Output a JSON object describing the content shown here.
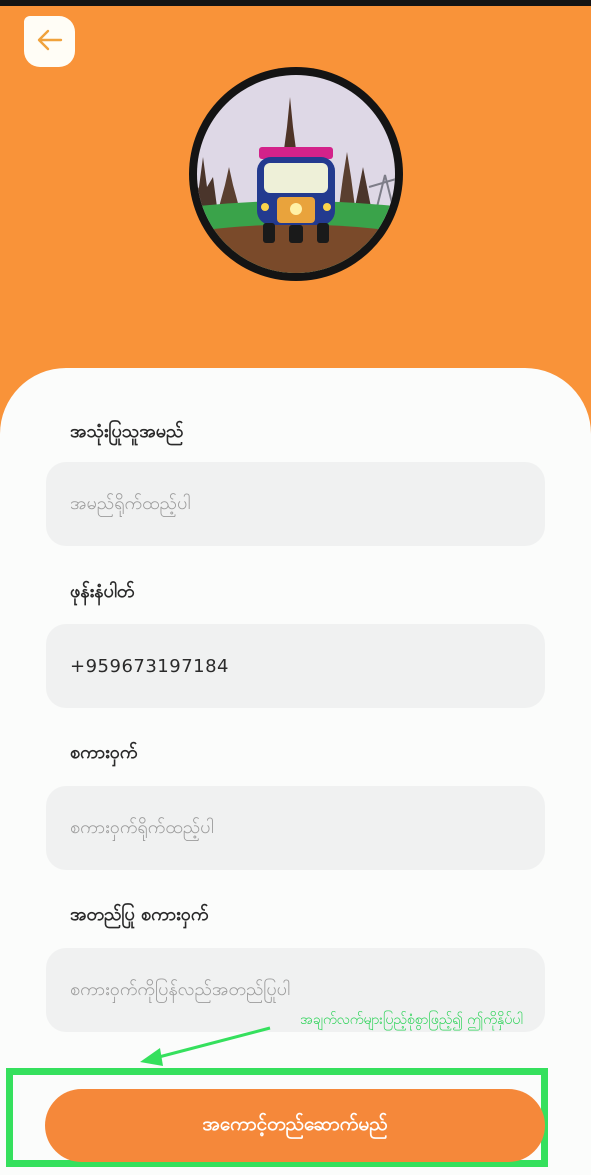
{
  "header": {
    "back_icon": "arrow-left-icon",
    "logo_icon": "tuk-tuk-temple-logo-icon"
  },
  "form": {
    "name_label": "အသုံးပြုသူအမည်",
    "name_placeholder": "အမည်ရိုက်ထည့်ပါ",
    "phone_label": "ဖုန်းနံပါတ်",
    "phone_value": "+959673197184",
    "password_label": "စကားဝှက်",
    "password_placeholder": "စကားဝှက်ရိုက်ထည့်ပါ",
    "confirm_label": "အတည်ပြု စကားဝှက်",
    "confirm_placeholder": "စကားဝှက်ကိုပြန်လည်အတည်ပြုပါ"
  },
  "annotation": {
    "text": "အချက်လက်များပြည့်စုံစွာဖြည့်၍ ဤကိုနှိပ်ပါ"
  },
  "submit_label": "အကောင့်တည်ဆောက်မည်",
  "colors": {
    "header": "#f99339",
    "button": "#f5883a",
    "highlight": "#35e05d"
  }
}
